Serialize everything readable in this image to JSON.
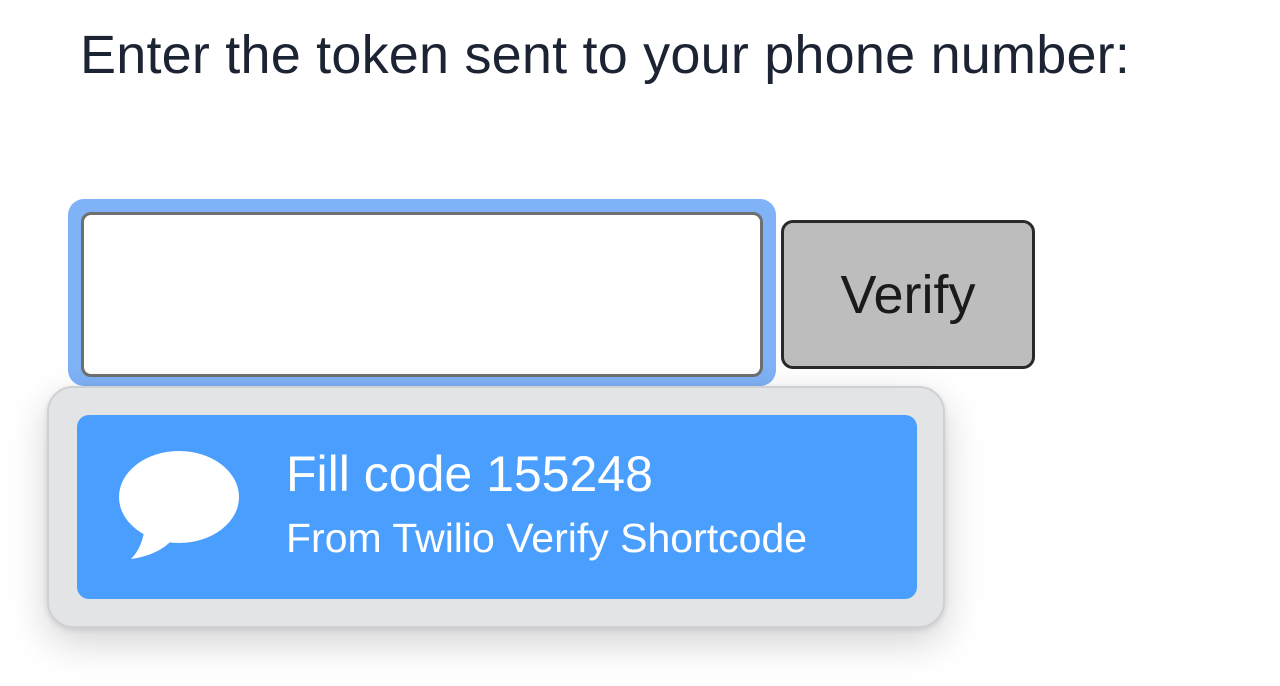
{
  "prompt": {
    "text": "Enter the token sent to your phone number:"
  },
  "token_field": {
    "value": "",
    "focused": true
  },
  "verify_button": {
    "label": "Verify"
  },
  "autofill": {
    "icon": "message-bubble-icon",
    "title": "Fill code 155248",
    "subtitle": "From Twilio Verify Shortcode"
  },
  "colors": {
    "focus_ring": "#7fb2f7",
    "suggestion_highlight": "#4a9ffe",
    "button_bg": "#bdbdbd",
    "text": "#1c2433"
  }
}
